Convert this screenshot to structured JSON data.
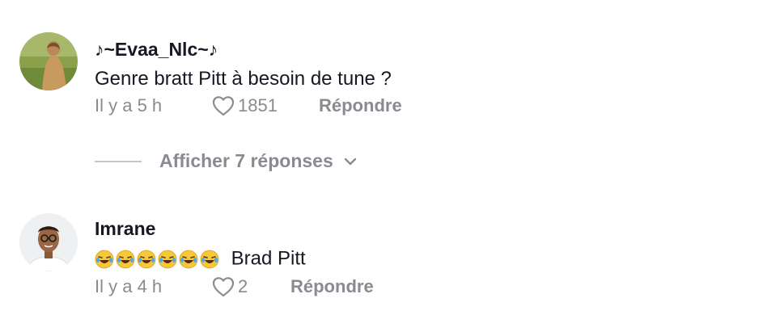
{
  "comments": [
    {
      "username": "♪~Evaa_Nlc~♪",
      "text": "Genre bratt Pitt à besoin de tune ?",
      "time": "Il y a 5 h",
      "likes": "1851",
      "reply_label": "Répondre",
      "view_replies": "Afficher 7 réponses"
    },
    {
      "username": "Imrane",
      "emoji": "😂😂😂😂😂😂",
      "text": "Brad Pitt",
      "time": "Il y a 4 h",
      "likes": "2",
      "reply_label": "Répondre"
    }
  ],
  "colors": {
    "text_primary": "#161823",
    "text_secondary": "#8a8b91",
    "divider": "#c4c5c9"
  },
  "icons": {
    "like": "heart-outline-icon",
    "expand": "chevron-down-icon"
  }
}
